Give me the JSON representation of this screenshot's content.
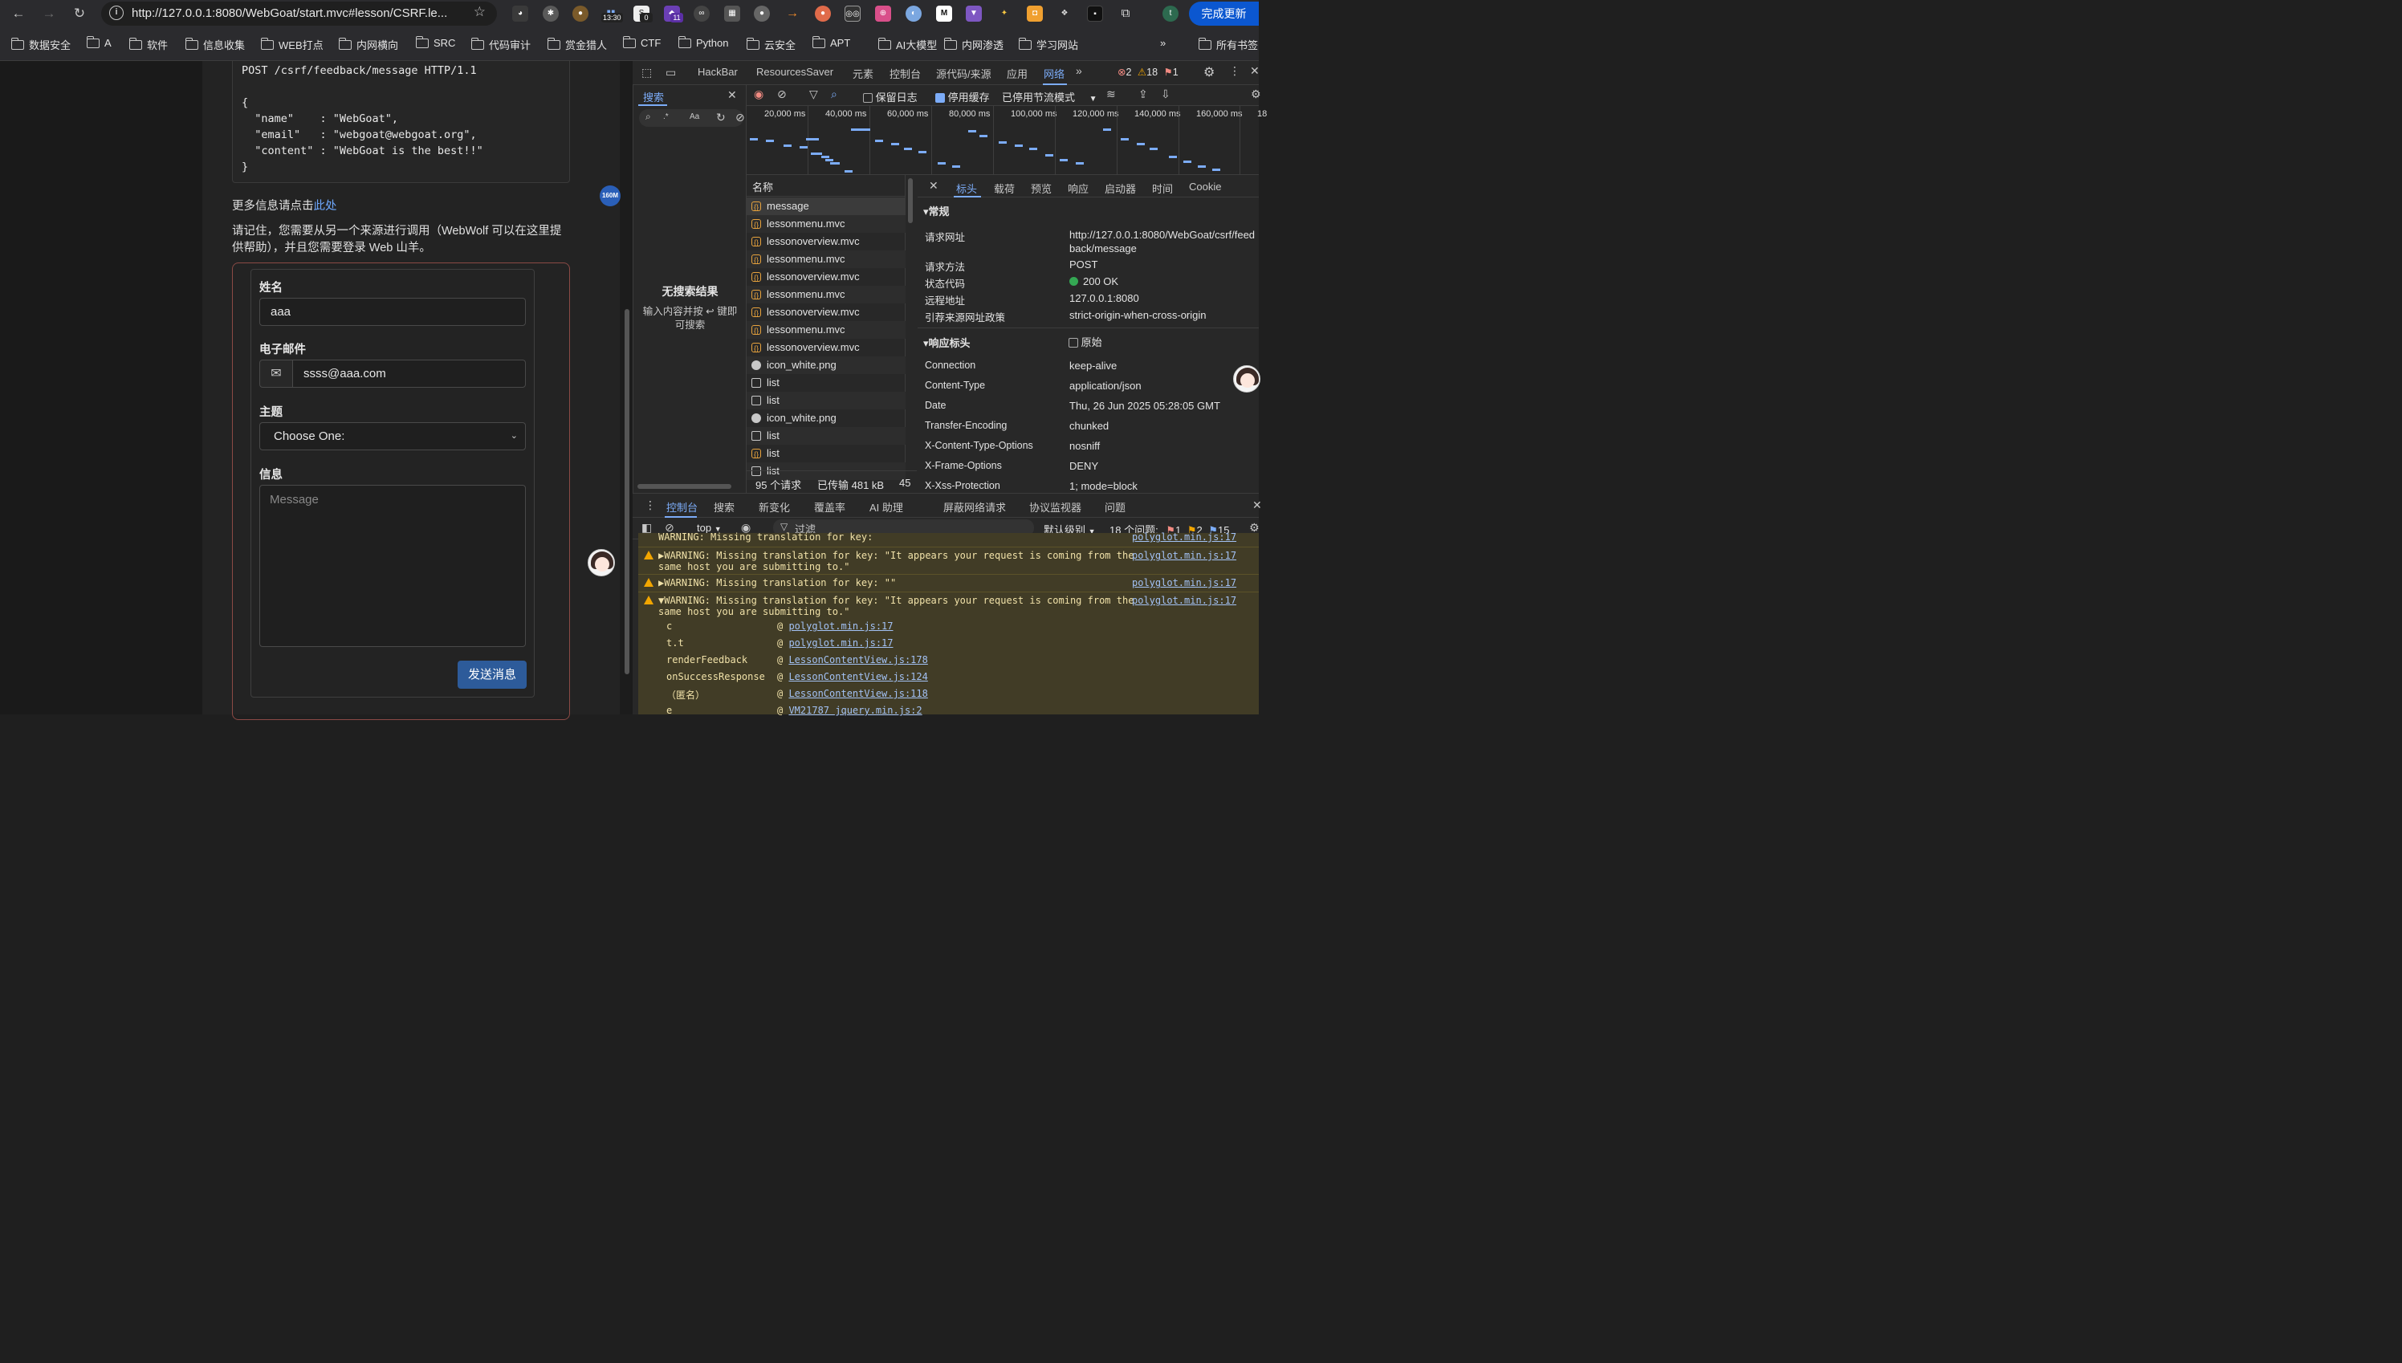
{
  "browser": {
    "url": "http://127.0.0.1:8080/WebGoat/start.mvc#lesson/CSRF.le...",
    "update_button": "完成更新",
    "profile_letter": "t",
    "ext_time": "13:30",
    "ext_count_a": "0",
    "ext_count_b": "11",
    "bookmarks": [
      "数据安全",
      "A",
      "软件",
      "信息收集",
      "WEB打点",
      "内网横向",
      "SRC",
      "代码审计",
      "赏金猎人",
      "CTF",
      "Python",
      "云安全",
      "APT",
      "AI大模型",
      "内网渗透",
      "学习网站"
    ],
    "all_bookmarks": "所有书签",
    "more": "»"
  },
  "page": {
    "code_lines": "POST /csrf/feedback/message HTTP/1.1\n\n{\n  \"name\"    : \"WebGoat\",\n  \"email\"   : \"webgoat@webgoat.org\",\n  \"content\" : \"WebGoat is the best!!\"\n}",
    "more_info_prefix": "更多信息请点击",
    "more_info_link": "此处",
    "note_line1": "请记住，您需要从另一个来源进行调用（WebWolf 可以在这里提",
    "note_line2": "供帮助），并且您需要登录 Web 山羊。",
    "badge_memory": "160M",
    "form": {
      "name_label": "姓名",
      "name_value": "aaa",
      "email_label": "电子邮件",
      "email_value": "ssss@aaa.com",
      "subject_label": "主题",
      "subject_value": "Choose One:",
      "message_label": "信息",
      "message_placeholder": "Message",
      "send_button": "发送消息"
    }
  },
  "devtools": {
    "top_tabs": [
      "HackBar",
      "ResourcesSaver",
      "元素",
      "控制台",
      "源代码/来源",
      "应用",
      "网络"
    ],
    "active_top_tab": "网络",
    "error_count": "2",
    "warn_count": "18",
    "info_count": "1",
    "search": {
      "title": "搜索",
      "no_results": "无搜索结果",
      "hint_line1": "输入内容并按 ↩ 键即",
      "hint_line2": "可搜索",
      "opt_case": "Aa",
      "opt_regex": ".*"
    },
    "network_toolbar": {
      "preserve_log": "保留日志",
      "disable_cache": "停用缓存",
      "throttle": "已停用节流模式"
    },
    "overview_ticks": [
      "20,000 ms",
      "40,000 ms",
      "60,000 ms",
      "80,000 ms",
      "100,000 ms",
      "120,000 ms",
      "140,000 ms",
      "160,000 ms",
      "18"
    ],
    "name_header": "名称",
    "requests": [
      {
        "name": "message",
        "type": "fetch"
      },
      {
        "name": "lessonmenu.mvc",
        "type": "fetch"
      },
      {
        "name": "lessonoverview.mvc",
        "type": "fetch"
      },
      {
        "name": "lessonmenu.mvc",
        "type": "fetch"
      },
      {
        "name": "lessonoverview.mvc",
        "type": "fetch"
      },
      {
        "name": "lessonmenu.mvc",
        "type": "fetch"
      },
      {
        "name": "lessonoverview.mvc",
        "type": "fetch"
      },
      {
        "name": "lessonmenu.mvc",
        "type": "fetch"
      },
      {
        "name": "lessonoverview.mvc",
        "type": "fetch"
      },
      {
        "name": "icon_white.png",
        "type": "img"
      },
      {
        "name": "list",
        "type": "doc"
      },
      {
        "name": "list",
        "type": "doc"
      },
      {
        "name": "icon_white.png",
        "type": "img"
      },
      {
        "name": "list",
        "type": "doc"
      },
      {
        "name": "list",
        "type": "fetch"
      },
      {
        "name": "list",
        "type": "doc"
      }
    ],
    "footer": {
      "requests": "95 个请求",
      "transferred": "已传输 481 kB",
      "extra": "45"
    },
    "detail_tabs": [
      "标头",
      "载荷",
      "预览",
      "响应",
      "启动器",
      "时间",
      "Cookie"
    ],
    "active_detail_tab": "标头",
    "general": {
      "title": "常规",
      "rows": [
        {
          "k": "请求网址",
          "v": "http://127.0.0.1:8080/WebGoat/csrf/feed",
          "v2": "back/message"
        },
        {
          "k": "请求方法",
          "v": "POST"
        },
        {
          "k": "状态代码",
          "v": "200 OK"
        },
        {
          "k": "远程地址",
          "v": "127.0.0.1:8080"
        },
        {
          "k": "引荐来源网址政策",
          "v": "strict-origin-when-cross-origin"
        }
      ]
    },
    "response_headers": {
      "title": "响应标头",
      "raw_label": "原始",
      "rows": [
        {
          "k": "Connection",
          "v": "keep-alive"
        },
        {
          "k": "Content-Type",
          "v": "application/json"
        },
        {
          "k": "Date",
          "v": "Thu, 26 Jun 2025 05:28:05 GMT"
        },
        {
          "k": "Transfer-Encoding",
          "v": "chunked"
        },
        {
          "k": "X-Content-Type-Options",
          "v": "nosniff"
        },
        {
          "k": "X-Frame-Options",
          "v": "DENY"
        },
        {
          "k": "X-Xss-Protection",
          "v": "1; mode=block"
        }
      ]
    },
    "drawer_tabs": [
      "控制台",
      "搜索",
      "新变化",
      "覆盖率",
      "AI 助理",
      "屏蔽网络请求",
      "协议监视器",
      "问题"
    ],
    "active_drawer_tab": "控制台",
    "console_bar": {
      "context": "top",
      "filter": "过滤",
      "level": "默认级别",
      "issues": "18 个问题:",
      "iss_err": "1",
      "iss_warn": "2",
      "iss_info": "15"
    },
    "console": {
      "clipped_top": "WARNING: Missing translation for key: ",
      "clipped_src": "polyglot.min.js:17",
      "warn1_a": "▶WARNING: Missing translation for key: \"It appears your request is coming from the",
      "warn1_b": "same host you are submitting to.\"",
      "warn1_src": "polyglot.min.js:17",
      "warn2_a": "▶WARNING: Missing translation for key: \"\"",
      "warn2_src": "polyglot.min.js:17",
      "warn3_a": "▼WARNING: Missing translation for key: \"It appears your request is coming from the",
      "warn3_b": "same host you are submitting to.\"",
      "warn3_src": "polyglot.min.js:17",
      "stack": [
        {
          "fn": "c",
          "src": "polyglot.min.js:17"
        },
        {
          "fn": "t.t",
          "src": "polyglot.min.js:17"
        },
        {
          "fn": "renderFeedback",
          "src": "LessonContentView.js:178"
        },
        {
          "fn": "onSuccessResponse",
          "src": "LessonContentView.js:124"
        },
        {
          "fn": "（匿名）",
          "src": "LessonContentView.js:118"
        },
        {
          "fn": "e",
          "src": "VM21787 jquery.min.js:2"
        }
      ]
    }
  }
}
